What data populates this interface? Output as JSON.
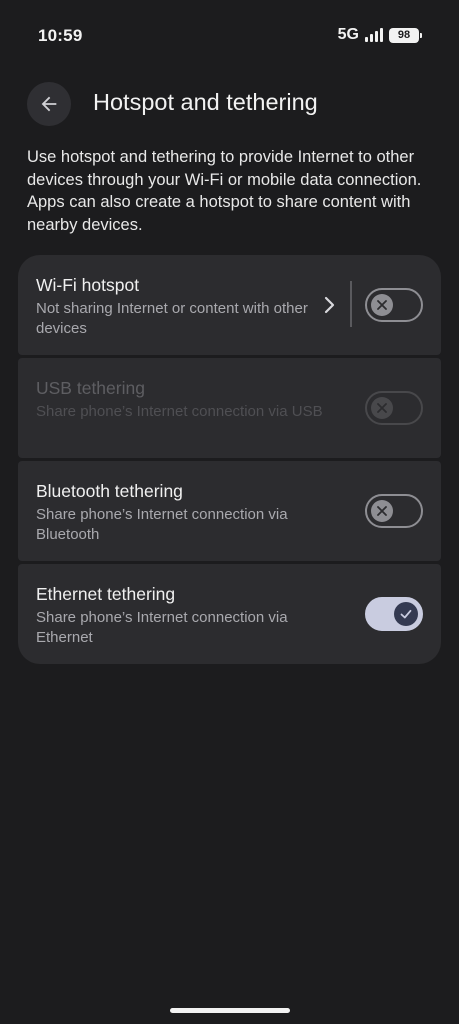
{
  "status_bar": {
    "time": "10:59",
    "network": "5G",
    "battery": "98"
  },
  "header": {
    "title": "Hotspot and tethering"
  },
  "description": "Use hotspot and tethering to provide Internet to other devices through your Wi-Fi or mobile data connection. Apps can also create a hotspot to share content with nearby devices.",
  "settings": [
    {
      "title": "Wi-Fi hotspot",
      "subtitle": "Not sharing Internet or content with other devices",
      "enabled": true,
      "checked": false
    },
    {
      "title": "USB tethering",
      "subtitle": "Share phone’s Internet connection via USB",
      "enabled": false,
      "checked": false
    },
    {
      "title": "Bluetooth tethering",
      "subtitle": "Share phone’s Internet connection via Bluetooth",
      "enabled": true,
      "checked": false
    },
    {
      "title": "Ethernet tethering",
      "subtitle": "Share phone’s Internet connection via Ethernet",
      "enabled": true,
      "checked": true
    }
  ],
  "colors": {
    "background": "#1c1c1e",
    "card": "#2c2c2f",
    "toggle_on": "#c9cce0",
    "toggle_off": "#8e8e93"
  }
}
